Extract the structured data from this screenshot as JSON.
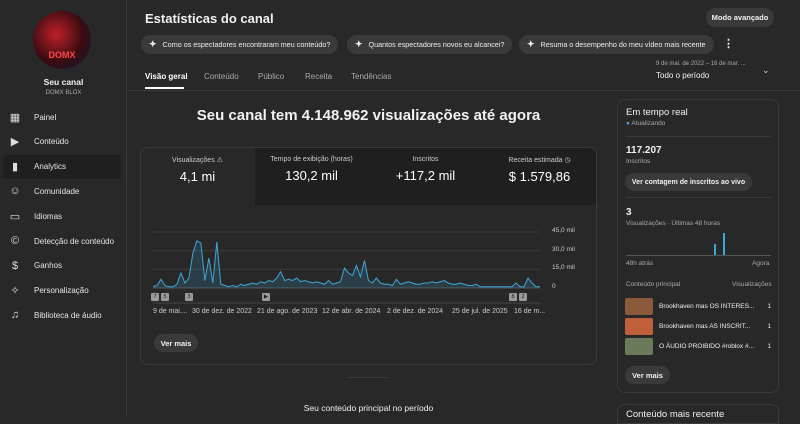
{
  "sidebar": {
    "channel_label": "Seu canal",
    "channel_name": "DOMX BLOX",
    "avatar_text": "DOMX",
    "items": [
      {
        "label": "Painel",
        "icon": "dashboard-icon"
      },
      {
        "label": "Conteúdo",
        "icon": "content-icon"
      },
      {
        "label": "Analytics",
        "icon": "analytics-icon"
      },
      {
        "label": "Comunidade",
        "icon": "community-icon"
      },
      {
        "label": "Idiomas",
        "icon": "subtitles-icon"
      },
      {
        "label": "Detecção de conteúdo",
        "icon": "copyright-icon"
      },
      {
        "label": "Ganhos",
        "icon": "dollar-icon"
      },
      {
        "label": "Personalização",
        "icon": "magic-wand-icon"
      },
      {
        "label": "Biblioteca de áudio",
        "icon": "audio-library-icon"
      }
    ]
  },
  "header": {
    "title": "Estatísticas do canal",
    "advanced_mode": "Modo avançado",
    "chips": [
      "Como os espectadores encontraram meu conteúdo?",
      "Quantos espectadores novos eu alcancei?",
      "Resuma o desempenho do meu vídeo mais recente"
    ],
    "tabs": [
      "Visão geral",
      "Conteúdo",
      "Público",
      "Receita",
      "Tendências"
    ],
    "date_range": "9 de mai. de 2022 – 16 de mar. ...",
    "period": "Todo o período"
  },
  "main": {
    "headline": "Seu canal tem 4.148.962 visualizações até agora",
    "metrics": [
      {
        "label": "Visualizações",
        "value": "4,1 mi"
      },
      {
        "label": "Tempo de exibição (horas)",
        "value": "130,2 mil"
      },
      {
        "label": "Inscritos",
        "value": "+117,2 mil"
      },
      {
        "label": "Receita estimada",
        "value": "$ 1.579,86"
      }
    ],
    "markers": [
      "7",
      "5",
      "3",
      "▶",
      "8",
      "2"
    ],
    "see_more": "Ver mais",
    "bottom_title": "Seu conteúdo principal no período"
  },
  "chart_data": {
    "type": "area",
    "title": "Visualizações",
    "y_ticks": [
      "45,0 mil",
      "30,0 mil",
      "15,0 mil",
      "0"
    ],
    "ylim": [
      0,
      45
    ],
    "unit": "mil",
    "x_labels": [
      "9 de mai....",
      "30 de dez. de 2022",
      "21 de ago. de 2023",
      "12 de abr. de 2024",
      "2 de dez. de 2024",
      "25 de jul. de 2025",
      "16 de m..."
    ],
    "values": [
      1,
      2,
      7,
      2,
      1,
      1,
      3,
      12,
      4,
      8,
      28,
      38,
      36,
      6,
      24,
      4,
      37,
      3,
      2,
      1,
      2,
      1,
      3,
      2,
      3,
      4,
      3,
      5,
      4,
      6,
      5,
      8,
      13,
      6,
      7,
      6,
      8,
      5,
      6,
      5,
      4,
      5,
      4,
      3,
      6,
      3,
      4,
      5,
      16,
      12,
      10,
      18,
      9,
      22,
      6,
      4,
      8,
      4,
      3,
      3,
      2,
      7,
      3,
      4,
      5,
      4,
      3,
      3,
      4,
      4,
      5,
      4,
      5,
      6,
      4,
      3,
      3,
      4,
      3,
      2,
      2,
      3,
      1,
      1,
      1,
      1,
      1,
      1,
      1,
      1,
      1,
      4,
      1,
      1,
      8,
      4,
      1,
      1
    ],
    "color": "#3ea6d8"
  },
  "realtime": {
    "title": "Em tempo real",
    "status": "Atualizando",
    "subs": "117.207",
    "subs_label": "Inscritos",
    "live_button": "Ver contagem de inscritos ao vivo",
    "views": "3",
    "views_label": "Visualizações · Últimas 48 horas",
    "left": "48h atrás",
    "right": "Agora",
    "bars": [
      {
        "hour_ago": 19,
        "views": 1
      },
      {
        "hour_ago": 16,
        "views": 2
      }
    ],
    "col1": "Conteúdo principal",
    "col2": "Visualizações",
    "videos": [
      {
        "title": "Brookhaven mas OS INTERES...",
        "views": "1"
      },
      {
        "title": "Brookhaven mas AS INSCRIT...",
        "views": "1"
      },
      {
        "title": "O ÁUDIO PROIBIDO #roblox #...",
        "views": "1"
      }
    ],
    "see_more": "Ver mais",
    "recent_title": "Conteúdo mais recente"
  }
}
